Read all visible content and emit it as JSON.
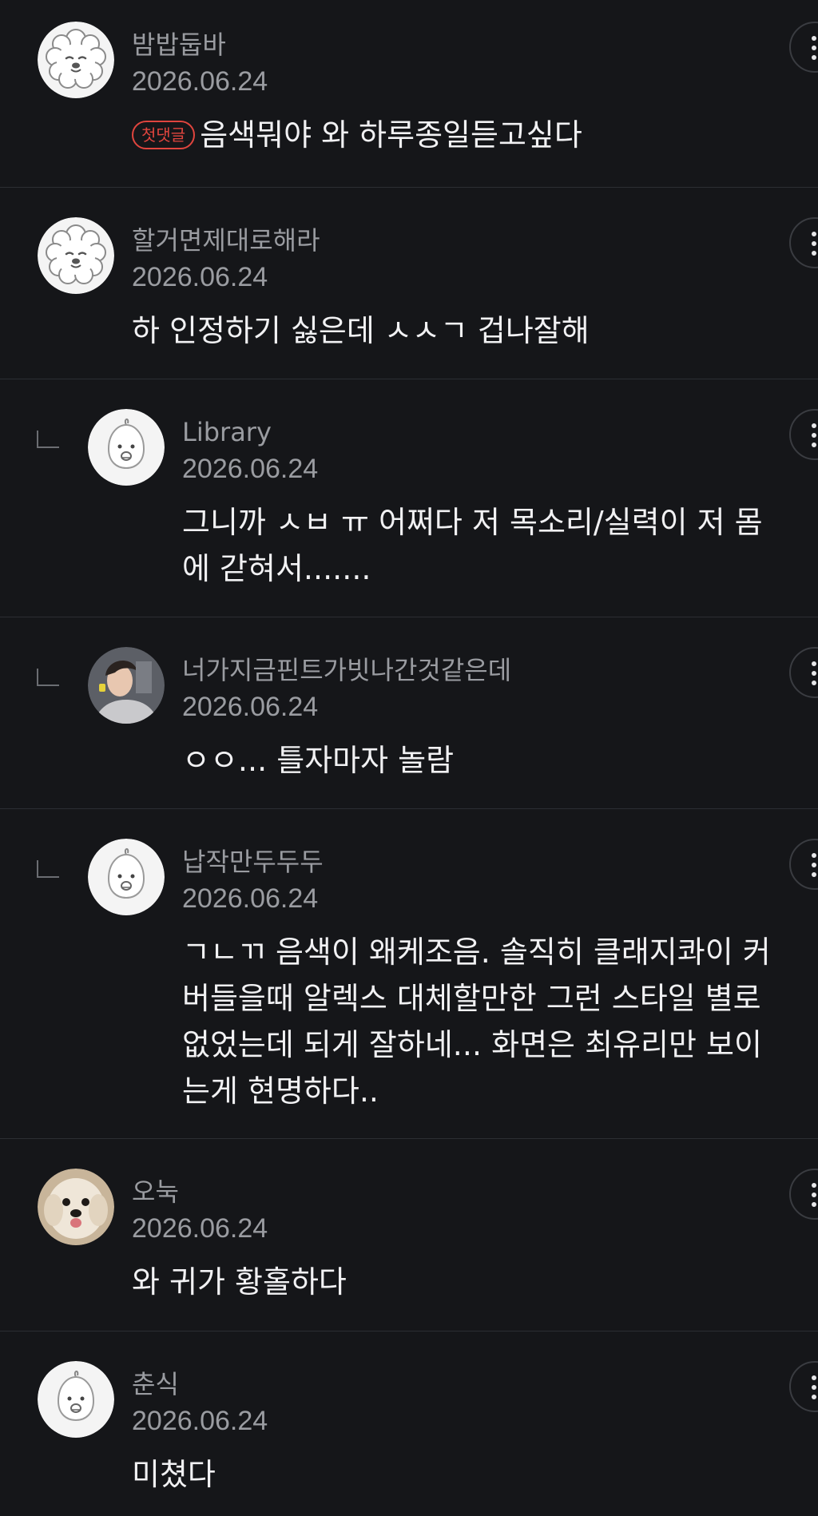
{
  "comments": [
    {
      "username": "밤밥둡바",
      "date": "2026.06.24",
      "badge": "첫댓글",
      "text": "음색뭐야 와 하루종일듣고싶다",
      "reply": false,
      "avatar": "poodle-icon"
    },
    {
      "username": "할거면제대로해라",
      "date": "2026.06.24",
      "text": "하 인정하기 싫은데 ㅅㅅㄱ 겁나잘해",
      "reply": false,
      "avatar": "poodle-icon"
    },
    {
      "username": "Library",
      "date": "2026.06.24",
      "text": "그니까 ㅅㅂ ㅠ 어쩌다 저 목소리/실력이 저 몸에 갇혀서.......",
      "reply": true,
      "avatar": "bun-face-icon"
    },
    {
      "username": "너가지금핀트가빗나간것같은데",
      "date": "2026.06.24",
      "text": "ㅇㅇ... 틀자마자 놀람",
      "reply": true,
      "avatar": "person-photo"
    },
    {
      "username": "납작만두두두",
      "date": "2026.06.24",
      "text": "ㄱㄴㄲ 음색이 왜케조음. 솔직히 클래지콰이 커버들을때 알렉스 대체할만한 그런 스타일 별로 없었는데 되게 잘하네... 화면은 최유리만 보이는게 현명하다..",
      "reply": true,
      "avatar": "bun-face-icon"
    },
    {
      "username": "오눅",
      "date": "2026.06.24",
      "text": "와 귀가 황홀하다",
      "reply": false,
      "avatar": "dog-photo"
    },
    {
      "username": "춘식",
      "date": "2026.06.24",
      "text": "미쳤다",
      "reply": false,
      "avatar": "bun-face-icon"
    }
  ],
  "colors": {
    "background": "#151619",
    "divider": "#2c2e33",
    "badge": "#e0453e",
    "muted_text": "#9a9ca1",
    "body_text": "#f1f1f3"
  }
}
